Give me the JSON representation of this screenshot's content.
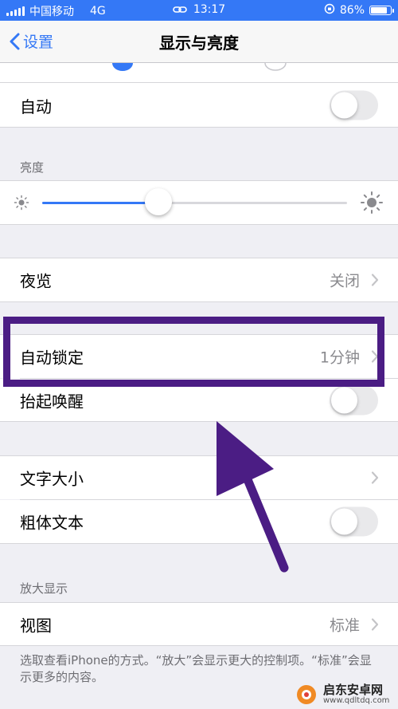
{
  "status_bar": {
    "carrier": "中国移动",
    "network": "4G",
    "time": "13:17",
    "battery_percent": "86%",
    "battery_level": 0.86
  },
  "nav": {
    "back_label": "设置",
    "title": "显示与亮度"
  },
  "appearance": {
    "auto_label": "自动",
    "auto_on": false
  },
  "brightness": {
    "header": "亮度",
    "level": 0.38
  },
  "night_shift": {
    "label": "夜览",
    "value": "关闭"
  },
  "auto_lock": {
    "label": "自动锁定",
    "value": "1分钟"
  },
  "raise_to_wake": {
    "label": "抬起唤醒",
    "on": false
  },
  "text_size": {
    "label": "文字大小"
  },
  "bold_text": {
    "label": "粗体文本",
    "on": false
  },
  "zoom": {
    "header": "放大显示",
    "view_label": "视图",
    "view_value": "标准"
  },
  "footer": {
    "text": "选取查看iPhone的方式。“放大”会显示更大的控制项。“标准”会显示更多的内容。"
  },
  "annotation": {
    "color": "#4b1d84"
  },
  "watermark": {
    "main": "启东安卓网",
    "sub": "www.qdltdq.com"
  },
  "colors": {
    "accent": "#3478f6",
    "background": "#efeff4"
  }
}
